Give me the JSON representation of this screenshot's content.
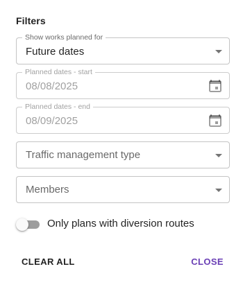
{
  "filters": {
    "title": "Filters",
    "show_works": {
      "label": "Show works planned for",
      "value": "Future dates"
    },
    "start_date": {
      "label": "Planned dates - start",
      "value": "08/08/2025"
    },
    "end_date": {
      "label": "Planned dates - end",
      "value": "08/09/2025"
    },
    "traffic_type": {
      "placeholder": "Traffic management type"
    },
    "members": {
      "placeholder": "Members"
    },
    "diversion": {
      "label": "Only plans with diversion routes",
      "checked": false
    }
  },
  "actions": {
    "clear_label": "CLEAR ALL",
    "close_label": "CLOSE"
  },
  "colors": {
    "accent": "#6a3fb5",
    "toggle_off_track": "#9e9e9e"
  },
  "icons": {
    "date": "calendar-icon",
    "dropdown": "chevron-down-icon"
  }
}
